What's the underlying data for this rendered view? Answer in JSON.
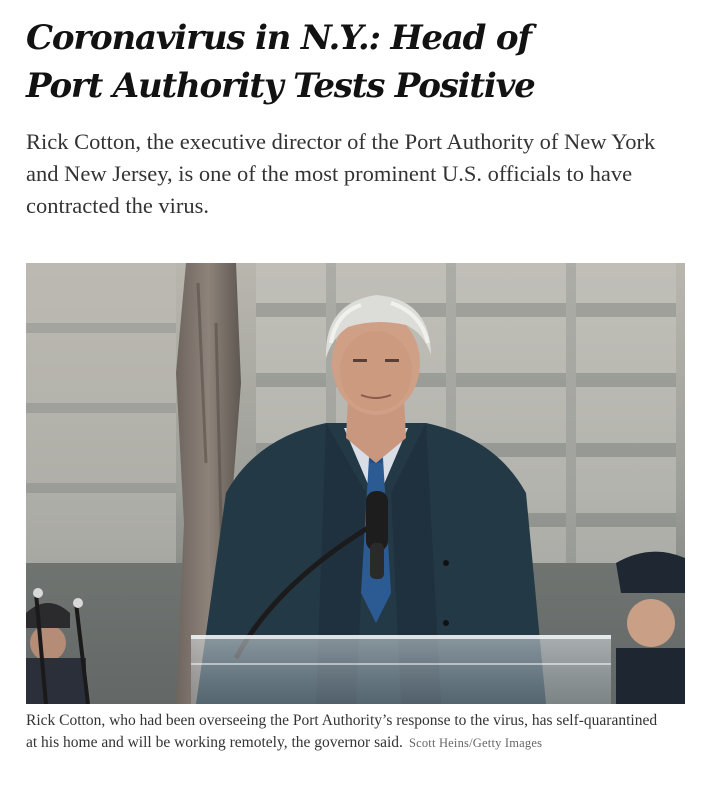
{
  "article": {
    "headline_line1": "Coronavirus in N.Y.: Head of",
    "headline_line2": "Port Authority Tests Positive",
    "summary": "Rick Cotton, the executive director of the Port Authority of New York and New Jersey, is one of the most prominent U.S. officials to have contracted the virus.",
    "caption": "Rick Cotton, who had been overseeing the Port Authority’s response to the virus, has self-quarantined at his home and will be working remotely, the governor said.",
    "credit": "Scott Heins/Getty Images"
  },
  "colors": {
    "text": "#121212",
    "summary_text": "#333333",
    "credit_text": "#666666",
    "jacket": "#243946",
    "tie": "#2c5b93"
  }
}
